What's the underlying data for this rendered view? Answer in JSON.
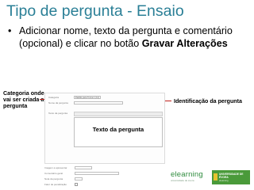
{
  "slide": {
    "title": "Tipo de pergunta - Ensaio",
    "bullet_text": "Adicionar nome, texto da pergunta e comentário (opcional) e clicar no botão",
    "bullet_bold": "Gravar Alterações"
  },
  "callouts": {
    "category": "Categoria onde vai ser criada a pergunta",
    "identification": "Identificação da pergunta",
    "question_text": "Texto da pergunta"
  },
  "form": {
    "category_label": "Categoria",
    "category_value": "Padrão para Turma 1 (14)",
    "name_label": "Nome da pergunta",
    "question_label": "Texto da pergunta",
    "image_label": "Imagem a apresentar",
    "feedback_label": "Comentário geral",
    "grade_label": "Nota da pergunta",
    "penalty_label": "Fator de penalização"
  },
  "branding": {
    "elearning": "elearning",
    "elearning_sub": "universidade de évora",
    "university": "UNIVERSIDADE DE ÉVORA",
    "university_sub": "elearning",
    "colors": {
      "title": "#2a7f96",
      "arrow": "#c0201b",
      "logo": "#2e8b3d"
    }
  }
}
